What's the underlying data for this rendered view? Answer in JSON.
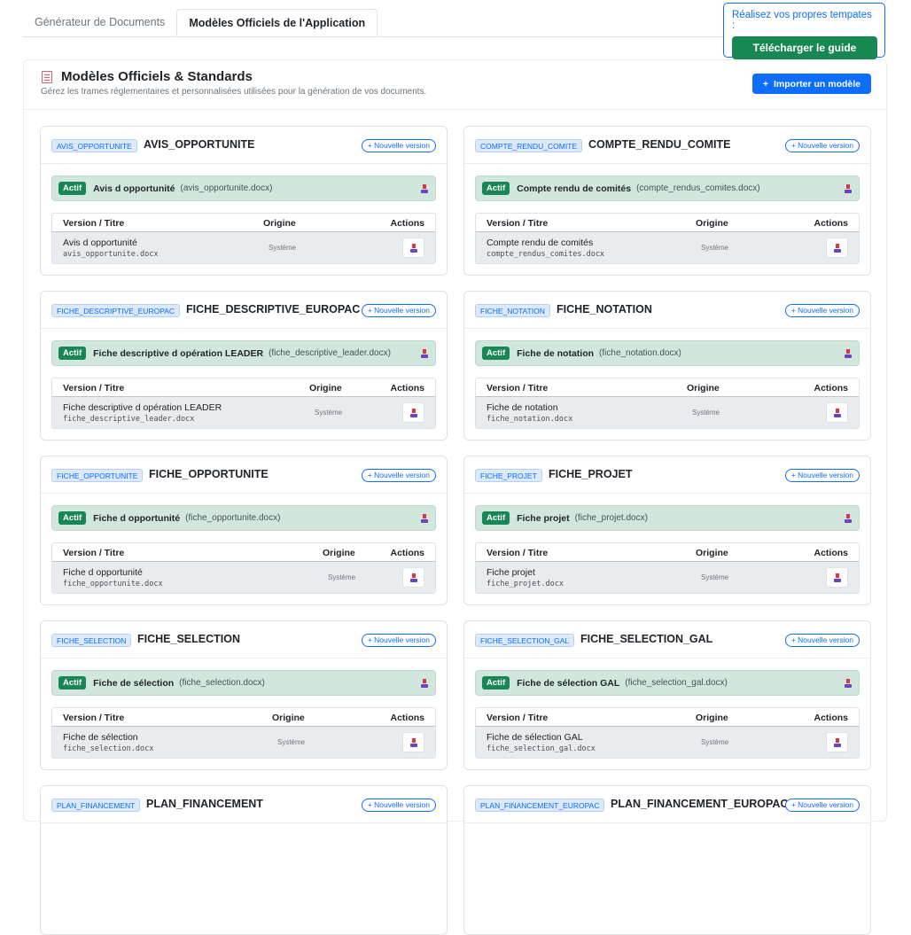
{
  "tabs": [
    {
      "label": "Générateur de Documents",
      "active": false
    },
    {
      "label": "Modèles Officiels de l'Application",
      "active": true
    }
  ],
  "guide": {
    "title": "Réalisez vos propres tempates :",
    "button_label": "Télécharger le guide"
  },
  "panel": {
    "title": "Modèles Officiels & Standards",
    "subtitle": "Gérez les trames réglementaires et personnalisées utilisées pour la génération de vos documents.",
    "import_label": "Importer un modèle"
  },
  "labels": {
    "new_version": "+ Nouvelle version",
    "actif": "Actif",
    "col_version": "Version / Titre",
    "col_origin": "Origine",
    "col_actions": "Actions",
    "origin_system": "Système"
  },
  "colors": {
    "primary": "#0d6efd",
    "success": "#198754",
    "active_bg": "#d1e7dd"
  },
  "templates": [
    {
      "code": "AVIS_OPPORTUNITE",
      "name": "AVIS_OPPORTUNITE",
      "active_title": "Avis d opportunité",
      "active_file": "(avis_opportunite.docx)",
      "version_title": "Avis d opportunité",
      "version_file": "avis_opportunite.docx"
    },
    {
      "code": "COMPTE_RENDU_COMITE",
      "name": "COMPTE_RENDU_COMITE",
      "active_title": "Compte rendu de comités",
      "active_file": "(compte_rendus_comites.docx)",
      "version_title": "Compte rendu de comités",
      "version_file": "compte_rendus_comites.docx"
    },
    {
      "code": "FICHE_DESCRIPTIVE_EUROPAC",
      "name": "FICHE_DESCRIPTIVE_EUROPAC",
      "active_title": "Fiche descriptive d opération LEADER",
      "active_file": "(fiche_descriptive_leader.docx)",
      "version_title": "Fiche descriptive d opération LEADER",
      "version_file": "fiche_descriptive_leader.docx"
    },
    {
      "code": "FICHE_NOTATION",
      "name": "FICHE_NOTATION",
      "active_title": "Fiche de notation",
      "active_file": "(fiche_notation.docx)",
      "version_title": "Fiche de notation",
      "version_file": "fiche_notation.docx"
    },
    {
      "code": "FICHE_OPPORTUNITE",
      "name": "FICHE_OPPORTUNITE",
      "active_title": "Fiche d opportunité",
      "active_file": "(fiche_opportunite.docx)",
      "version_title": "Fiche d opportunité",
      "version_file": "fiche_opportunite.docx"
    },
    {
      "code": "FICHE_PROJET",
      "name": "FICHE_PROJET",
      "active_title": "Fiche projet",
      "active_file": "(fiche_projet.docx)",
      "version_title": "Fiche projet",
      "version_file": "fiche_projet.docx"
    },
    {
      "code": "FICHE_SELECTION",
      "name": "FICHE_SELECTION",
      "active_title": "Fiche de sélection",
      "active_file": "(fiche_selection.docx)",
      "version_title": "Fiche de sélection",
      "version_file": "fiche_selection.docx"
    },
    {
      "code": "FICHE_SELECTION_GAL",
      "name": "FICHE_SELECTION_GAL",
      "active_title": "Fiche de sélection GAL",
      "active_file": "(fiche_selection_gal.docx)",
      "version_title": "Fiche de sélection GAL",
      "version_file": "fiche_selection_gal.docx"
    },
    {
      "code": "PLAN_FINANCEMENT",
      "name": "PLAN_FINANCEMENT"
    },
    {
      "code": "PLAN_FINANCEMENT_EUROPAC",
      "name": "PLAN_FINANCEMENT_EUROPAC"
    }
  ]
}
